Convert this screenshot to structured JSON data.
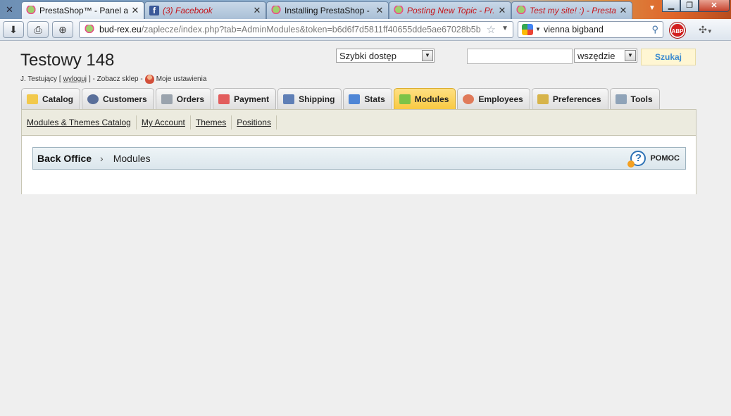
{
  "browser": {
    "tabs": [
      {
        "label": "PrestaShop™ - Panel a...",
        "favicon": "prestashop-icon",
        "active": true,
        "italic_red": false
      },
      {
        "label": "(3) Facebook",
        "favicon": "facebook-icon",
        "active": false,
        "italic_red": true
      },
      {
        "label": "Installing PrestaShop - ...",
        "favicon": "prestashop-icon",
        "active": false,
        "italic_red": false
      },
      {
        "label": "Posting New Topic - Pr...",
        "favicon": "prestashop-icon",
        "active": false,
        "italic_red": true
      },
      {
        "label": "Test my site! :) - Presta...",
        "favicon": "prestashop-icon",
        "active": false,
        "italic_red": true
      }
    ],
    "close_glyph": "✕",
    "url_host": "bud-rex.eu",
    "url_path": "/zaplecze/index.php?tab=AdminModules&token=b6d6f7d5811ff40655dde5ae67028b5b",
    "search_query": "vienna bigband",
    "abp_label": "ABP"
  },
  "header": {
    "shop_name": "Testowy 148",
    "user_name": "J. Testujący [",
    "logout": "wyloguj",
    "user_after": "] - Zobacz sklep -",
    "my_settings": "Moje ustawienia",
    "quick_access": "Szybki dostęp",
    "search_value": "",
    "search_scope": "wszędzie",
    "search_button": "Szukaj"
  },
  "menu": {
    "tabs": [
      {
        "label": "Catalog",
        "icon": "folder-icon",
        "color": "#f2c94c"
      },
      {
        "label": "Customers",
        "icon": "customer-icon",
        "color": "#5a6f9a"
      },
      {
        "label": "Orders",
        "icon": "cart-icon",
        "color": "#9aa3ad"
      },
      {
        "label": "Payment",
        "icon": "payment-icon",
        "color": "#e25d5d"
      },
      {
        "label": "Shipping",
        "icon": "truck-icon",
        "color": "#5f7fb6"
      },
      {
        "label": "Stats",
        "icon": "stats-icon",
        "color": "#4f86d6"
      },
      {
        "label": "Modules",
        "icon": "puzzle-icon",
        "color": "#7cc347"
      },
      {
        "label": "Employees",
        "icon": "employee-icon",
        "color": "#e07a5a"
      },
      {
        "label": "Preferences",
        "icon": "preferences-icon",
        "color": "#d7b44a"
      },
      {
        "label": "Tools",
        "icon": "wrench-icon",
        "color": "#8fa3b8"
      }
    ],
    "active": "Modules"
  },
  "submenu": {
    "items": [
      "Modules & Themes Catalog",
      "My Account",
      "Themes",
      "Positions"
    ]
  },
  "breadcrumb": {
    "root": "Back Office",
    "separator": "›",
    "current": "Modules",
    "help": "POMOC"
  }
}
